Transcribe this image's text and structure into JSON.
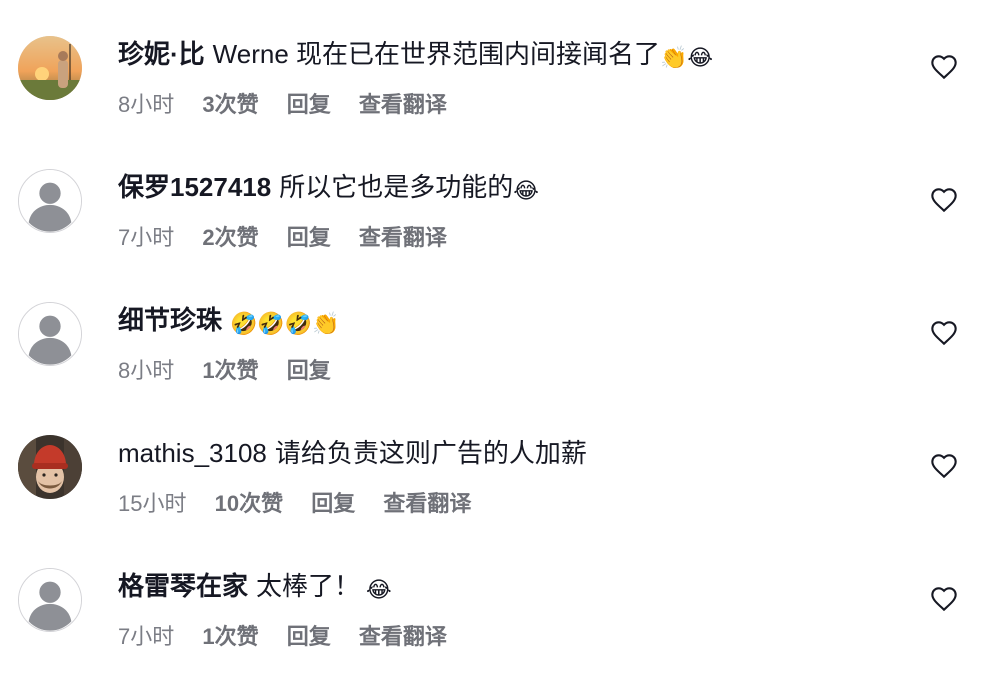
{
  "comments": [
    {
      "username": "珍妮·比",
      "text": "Werne 现在已在世界范围内间接闻名了",
      "emoji": "👏😂",
      "time": "8小时",
      "likes": "3次赞",
      "reply": "回复",
      "translate": "查看翻译",
      "avatar": "photo-sunset",
      "avatar_icon": "sunset-avatar-icon"
    },
    {
      "username": "保罗1527418",
      "text": "所以它也是多功能的",
      "emoji": "😂",
      "time": "7小时",
      "likes": "2次赞",
      "reply": "回复",
      "translate": "查看翻译",
      "avatar": "default-user",
      "avatar_icon": "default-user-icon"
    },
    {
      "username": "细节珍珠",
      "text": "",
      "emoji": "🤣🤣🤣👏",
      "time": "8小时",
      "likes": "1次赞",
      "reply": "回复",
      "translate": "",
      "avatar": "default-user",
      "avatar_icon": "default-user-icon"
    },
    {
      "username": "mathis_3108",
      "text": "请给负责这则广告的人加薪",
      "emoji": "",
      "time": "15小时",
      "likes": "10次赞",
      "reply": "回复",
      "translate": "查看翻译",
      "avatar": "photo-red-hat",
      "avatar_icon": "red-hat-avatar-icon"
    },
    {
      "username": "格雷琴在家",
      "text": "太棒了！",
      "emoji": "😂",
      "time": "7小时",
      "likes": "1次赞",
      "reply": "回复",
      "translate": "查看翻译",
      "avatar": "default-user",
      "avatar_icon": "default-user-icon"
    }
  ],
  "like_icon": "heart-outline-icon",
  "colors": {
    "text": "#161823",
    "meta": "#7b7d85",
    "heart": "#161823",
    "avatar_bg": "#dcdcdf"
  }
}
